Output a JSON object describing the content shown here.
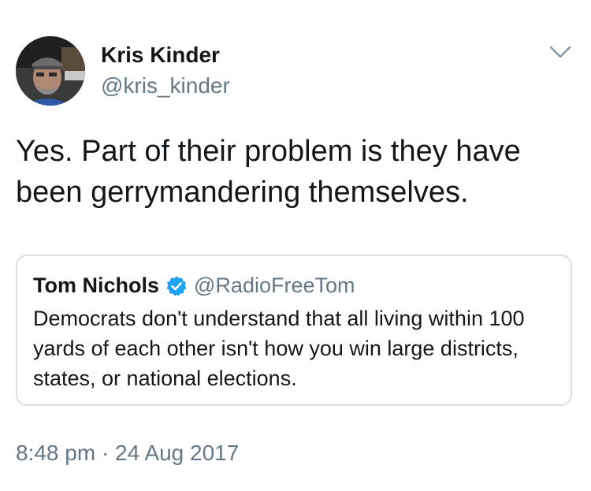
{
  "author": {
    "name": "Kris Kinder",
    "handle": "@kris_kinder",
    "avatar_icon": "profile-photo"
  },
  "tweet": {
    "text": "Yes. Part of their problem is they have been gerrymandering themselves.",
    "timestamp": "8:48 pm · 24 Aug 2017"
  },
  "quoted_tweet": {
    "name": "Tom Nichols",
    "handle": "@RadioFreeTom",
    "verified": true,
    "text": "Democrats don't understand that all living within 100 yards of each other isn't how you win large districts, states, or national elections."
  },
  "icons": {
    "menu": "chevron-down-icon",
    "verified": "verified-badge-icon"
  },
  "colors": {
    "text_primary": "#14171a",
    "text_secondary": "#657786",
    "verified_blue": "#1da1f2",
    "border": "#d9dfe4"
  }
}
